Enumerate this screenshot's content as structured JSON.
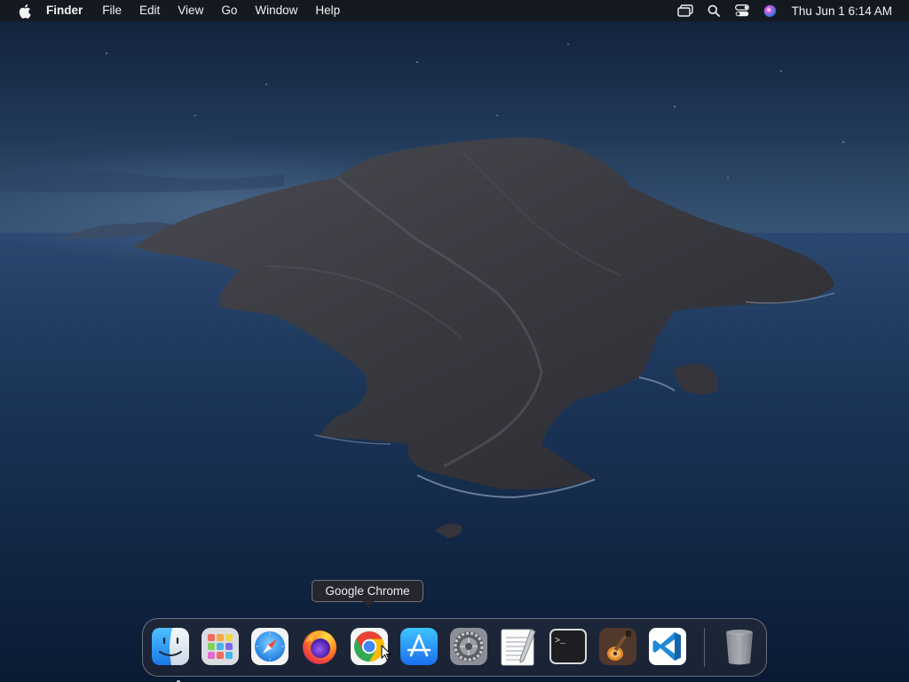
{
  "menubar": {
    "apple_icon": "apple-logo-icon",
    "app_name": "Finder",
    "menus": [
      "File",
      "Edit",
      "View",
      "Go",
      "Window",
      "Help"
    ],
    "status_icons": [
      "screen-mirroring-icon",
      "spotlight-search-icon",
      "control-center-icon",
      "siri-icon"
    ],
    "clock": "Thu Jun 1  6:14 AM"
  },
  "tooltip": {
    "text": "Google Chrome"
  },
  "dock": {
    "apps": [
      {
        "name": "Finder",
        "icon": "finder-icon",
        "running": true
      },
      {
        "name": "Launchpad",
        "icon": "launchpad-icon",
        "running": false
      },
      {
        "name": "Safari",
        "icon": "safari-icon",
        "running": false
      },
      {
        "name": "Firefox",
        "icon": "firefox-icon",
        "running": false
      },
      {
        "name": "Google Chrome",
        "icon": "chrome-icon",
        "running": false
      },
      {
        "name": "App Store",
        "icon": "app-store-icon",
        "running": false
      },
      {
        "name": "System Preferences",
        "icon": "system-preferences-icon",
        "running": false
      },
      {
        "name": "TextEdit",
        "icon": "textedit-icon",
        "running": false
      },
      {
        "name": "Terminal",
        "icon": "terminal-icon",
        "running": false
      },
      {
        "name": "GarageBand",
        "icon": "garageband-icon",
        "running": false
      },
      {
        "name": "Visual Studio Code",
        "icon": "vscode-icon",
        "running": false
      }
    ],
    "trash": {
      "name": "Trash",
      "icon": "trash-icon"
    }
  },
  "colors": {
    "menubar_bg": "#16181e",
    "wallpaper_sky": "#1d3352",
    "wallpaper_sea": "#14294a",
    "island": "#3a3a40"
  }
}
